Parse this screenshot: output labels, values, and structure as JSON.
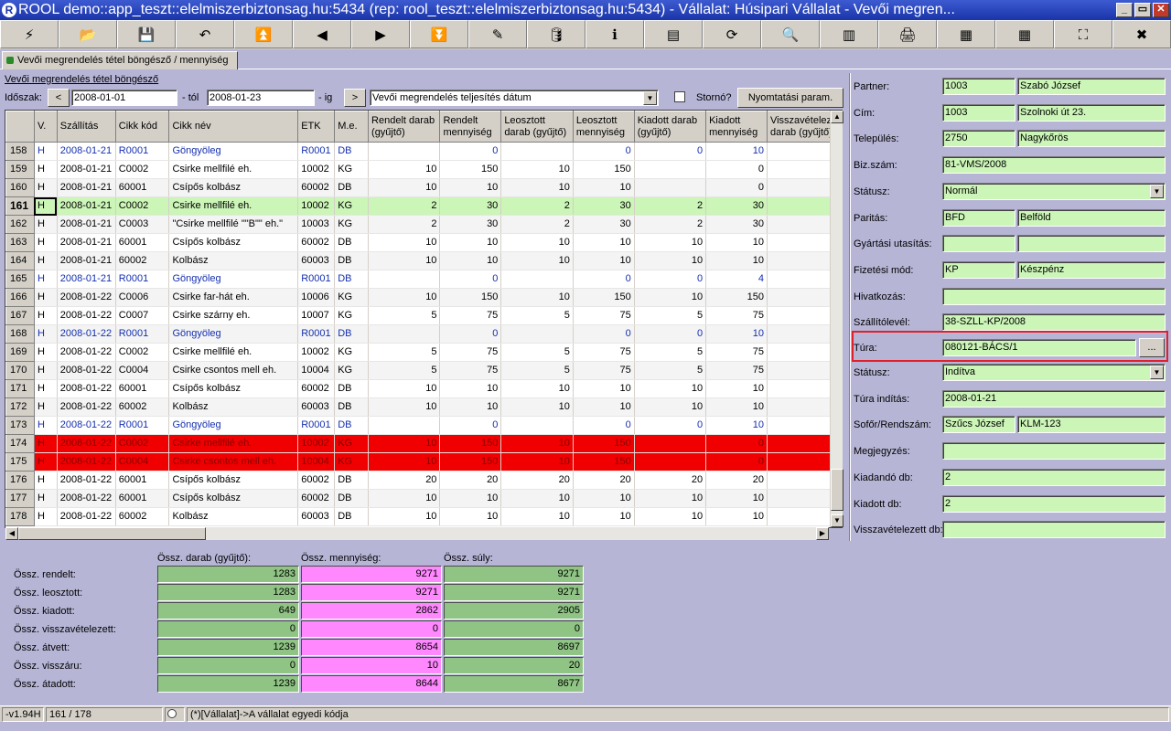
{
  "window": {
    "title": "ROOL demo::app_teszt::elelmiszerbiztonsag.hu:5434 (rep: rool_teszt::elelmiszerbiztonsag.hu:5434) - Vállalat: Húsipari Vállalat - Vevői megren...",
    "app_icon": "app-icon",
    "controls": [
      "_",
      "▭",
      "✕"
    ]
  },
  "toolbar": [
    {
      "icon": "lightning-icon",
      "glyph": "⚡"
    },
    {
      "icon": "open-folder-icon",
      "glyph": "📂"
    },
    {
      "icon": "save-disk-icon",
      "glyph": "💾"
    },
    {
      "icon": "undo-icon",
      "glyph": "↶"
    },
    {
      "icon": "first-record-icon",
      "glyph": "⏫"
    },
    {
      "icon": "previous-icon",
      "glyph": "◀"
    },
    {
      "icon": "next-icon",
      "glyph": "▶"
    },
    {
      "icon": "last-record-icon",
      "glyph": "⏬"
    },
    {
      "icon": "edit-icon",
      "glyph": "✎"
    },
    {
      "icon": "database-icon",
      "glyph": "🛢"
    },
    {
      "icon": "info-icon",
      "glyph": "ℹ"
    },
    {
      "icon": "form-view-icon",
      "glyph": "▤"
    },
    {
      "icon": "refresh-icon",
      "glyph": "⟳"
    },
    {
      "icon": "search-icon",
      "glyph": "🔍"
    },
    {
      "icon": "columns-icon",
      "glyph": "▥"
    },
    {
      "icon": "print-icon",
      "glyph": "🖨"
    },
    {
      "icon": "export-grid-icon",
      "glyph": "▦"
    },
    {
      "icon": "import-grid-icon",
      "glyph": "▦"
    },
    {
      "icon": "fullscreen-icon",
      "glyph": "⛶"
    },
    {
      "icon": "close-icon",
      "glyph": "✖"
    }
  ],
  "tab": {
    "label": "Vevői megrendelés tétel böngésző / mennyiség",
    "icon": "tab-icon"
  },
  "browser": {
    "link": "Vevői megrendelés tétel böngésző",
    "period_label": "Időszak:",
    "prev": "<",
    "next": ">",
    "from_value": "2008-01-01",
    "from_suffix": "- tól",
    "to_value": "2008-01-23",
    "to_suffix": "- ig",
    "date_type": "Vevői megrendelés teljesítés dátum",
    "storno_label": "Stornó?",
    "print_params": "Nyomtatási param."
  },
  "grid": {
    "columns": [
      "V.",
      "Szállítás",
      "Cikk kód",
      "Cikk név",
      "ETK",
      "M.e.",
      "Rendelt darab (gyűjtő)",
      "Rendelt mennyiség",
      "Leosztott darab (gyűjtő)",
      "Leosztott mennyiség",
      "Kiadott darab (gyűjtő)",
      "Kiadott mennyiség",
      "Visszavételez. darab (gyűjtő)"
    ],
    "rows": [
      {
        "n": "158",
        "style": "blue",
        "c": [
          "H",
          "2008-01-21",
          "R0001",
          " Göngyöleg",
          "R0001",
          "DB",
          "",
          "0",
          "",
          "0",
          "0",
          "10",
          ""
        ]
      },
      {
        "n": "159",
        "style": "",
        "c": [
          "H",
          "2008-01-21",
          "C0002",
          "Csirke mellfilé eh.",
          "10002",
          "KG",
          "10",
          "150",
          "10",
          "150",
          "",
          "0",
          ""
        ]
      },
      {
        "n": "160",
        "style": "alt",
        "c": [
          "H",
          "2008-01-21",
          "60001",
          "Csípős kolbász",
          "60002",
          "DB",
          "10",
          "10",
          "10",
          "10",
          "",
          "0",
          ""
        ]
      },
      {
        "n": "161",
        "style": "green",
        "c": [
          "H",
          "2008-01-21",
          "C0002",
          "Csirke mellfilé eh.",
          "10002",
          "KG",
          "2",
          "30",
          "2",
          "30",
          "2",
          "30",
          ""
        ]
      },
      {
        "n": "162",
        "style": "alt",
        "c": [
          "H",
          "2008-01-21",
          "C0003",
          "\"Csirke mellfilé \"\"B\"\" eh.\"",
          "10003",
          "KG",
          "2",
          "30",
          "2",
          "30",
          "2",
          "30",
          ""
        ]
      },
      {
        "n": "163",
        "style": "",
        "c": [
          "H",
          "2008-01-21",
          "60001",
          "Csípős kolbász",
          "60002",
          "DB",
          "10",
          "10",
          "10",
          "10",
          "10",
          "10",
          ""
        ]
      },
      {
        "n": "164",
        "style": "alt",
        "c": [
          "H",
          "2008-01-21",
          "60002",
          "Kolbász",
          "60003",
          "DB",
          "10",
          "10",
          "10",
          "10",
          "10",
          "10",
          ""
        ]
      },
      {
        "n": "165",
        "style": "blue",
        "c": [
          "H",
          "2008-01-21",
          "R0001",
          " Göngyöleg",
          "R0001",
          "DB",
          "",
          "0",
          "",
          "0",
          "0",
          "4",
          ""
        ]
      },
      {
        "n": "166",
        "style": "alt",
        "c": [
          "H",
          "2008-01-22",
          "C0006",
          "Csirke far-hát eh.",
          "10006",
          "KG",
          "10",
          "150",
          "10",
          "150",
          "10",
          "150",
          ""
        ]
      },
      {
        "n": "167",
        "style": "",
        "c": [
          "H",
          "2008-01-22",
          "C0007",
          "Csirke szárny eh.",
          "10007",
          "KG",
          "5",
          "75",
          "5",
          "75",
          "5",
          "75",
          ""
        ]
      },
      {
        "n": "168",
        "style": "blue alt",
        "c": [
          "H",
          "2008-01-22",
          "R0001",
          " Göngyöleg",
          "R0001",
          "DB",
          "",
          "0",
          "",
          "0",
          "0",
          "10",
          ""
        ]
      },
      {
        "n": "169",
        "style": "",
        "c": [
          "H",
          "2008-01-22",
          "C0002",
          "Csirke mellfilé eh.",
          "10002",
          "KG",
          "5",
          "75",
          "5",
          "75",
          "5",
          "75",
          ""
        ]
      },
      {
        "n": "170",
        "style": "alt",
        "c": [
          "H",
          "2008-01-22",
          "C0004",
          "Csirke csontos mell eh.",
          "10004",
          "KG",
          "5",
          "75",
          "5",
          "75",
          "5",
          "75",
          ""
        ]
      },
      {
        "n": "171",
        "style": "",
        "c": [
          "H",
          "2008-01-22",
          "60001",
          "Csípős kolbász",
          "60002",
          "DB",
          "10",
          "10",
          "10",
          "10",
          "10",
          "10",
          ""
        ]
      },
      {
        "n": "172",
        "style": "alt",
        "c": [
          "H",
          "2008-01-22",
          "60002",
          "Kolbász",
          "60003",
          "DB",
          "10",
          "10",
          "10",
          "10",
          "10",
          "10",
          ""
        ]
      },
      {
        "n": "173",
        "style": "blue",
        "c": [
          "H",
          "2008-01-22",
          "R0001",
          " Göngyöleg",
          "R0001",
          "DB",
          "",
          "0",
          "",
          "0",
          "0",
          "10",
          ""
        ]
      },
      {
        "n": "174",
        "style": "red",
        "c": [
          "H",
          "2008-01-22",
          "C0002",
          "Csirke mellfilé eh.",
          "10002",
          "KG",
          "10",
          "150",
          "10",
          "150",
          "",
          "0",
          ""
        ]
      },
      {
        "n": "175",
        "style": "red",
        "c": [
          "H",
          "2008-01-22",
          "C0004",
          "Csirke csontos mell eh.",
          "10004",
          "KG",
          "10",
          "150",
          "10",
          "150",
          "",
          "0",
          ""
        ]
      },
      {
        "n": "176",
        "style": "",
        "c": [
          "H",
          "2008-01-22",
          "60001",
          "Csípős kolbász",
          "60002",
          "DB",
          "20",
          "20",
          "20",
          "20",
          "20",
          "20",
          ""
        ]
      },
      {
        "n": "177",
        "style": "alt",
        "c": [
          "H",
          "2008-01-22",
          "60001",
          "Csípős kolbász",
          "60002",
          "DB",
          "10",
          "10",
          "10",
          "10",
          "10",
          "10",
          ""
        ]
      },
      {
        "n": "178",
        "style": "",
        "c": [
          "H",
          "2008-01-22",
          "60002",
          "Kolbász",
          "60003",
          "DB",
          "10",
          "10",
          "10",
          "10",
          "10",
          "10",
          ""
        ]
      }
    ]
  },
  "detail": {
    "partner": {
      "label": "Partner:",
      "code": "1003",
      "name": "Szabó József"
    },
    "cim": {
      "label": "Cím:",
      "code": "1003",
      "name": "Szolnoki út 23."
    },
    "telepules": {
      "label": "Település:",
      "code": "2750",
      "name": "Nagykőrös"
    },
    "bizszam": {
      "label": "Biz.szám:",
      "value": "81-VMS/2008"
    },
    "statusz1": {
      "label": "Státusz:",
      "value": "Normál"
    },
    "paritas": {
      "label": "Paritás:",
      "code": "BFD",
      "name": "Belföld"
    },
    "gyartasi": {
      "label": "Gyártási utasítás:",
      "code": "",
      "name": ""
    },
    "fizetesi": {
      "label": "Fizetési mód:",
      "code": "KP",
      "name": "Készpénz"
    },
    "hivatkozas": {
      "label": "Hivatkozás:",
      "value": ""
    },
    "szallitolevel": {
      "label": "Szállítólevél:",
      "value": "38-SZLL-KP/2008"
    },
    "tura": {
      "label": "Túra:",
      "value": "080121-BÁCS/1",
      "button": "..."
    },
    "statusz2": {
      "label": "Státusz:",
      "value": "Indítva"
    },
    "turainditas": {
      "label": "Túra indítás:",
      "value": "2008-01-21"
    },
    "sofor": {
      "label": "Sofőr/Rendszám:",
      "name": "Szűcs József",
      "plate": "KLM-123"
    },
    "megjegyzes": {
      "label": "Megjegyzés:",
      "value": ""
    },
    "kiadando": {
      "label": "Kiadandó db:",
      "value": "2"
    },
    "kiadott": {
      "label": "Kiadott db:",
      "value": "2"
    },
    "visszavet": {
      "label": "Visszavételezett db:",
      "value": ""
    }
  },
  "summary": {
    "headers": [
      "Össz. darab (gyűjtő):",
      "Össz. mennyiség:",
      "Össz. súly:"
    ],
    "rows": [
      {
        "label": "Össz. rendelt:",
        "v": [
          "1283",
          "9271",
          "9271"
        ]
      },
      {
        "label": "Össz. leosztott:",
        "v": [
          "1283",
          "9271",
          "9271"
        ]
      },
      {
        "label": "Össz. kiadott:",
        "v": [
          "649",
          "2862",
          "2905"
        ]
      },
      {
        "label": "Össz. visszavételezett:",
        "v": [
          "0",
          "0",
          "0"
        ]
      },
      {
        "label": "Össz. átvett:",
        "v": [
          "1239",
          "8654",
          "8697"
        ]
      },
      {
        "label": "Össz. visszáru:",
        "v": [
          "0",
          "10",
          "20"
        ]
      },
      {
        "label": "Össz. átadott:",
        "v": [
          "1239",
          "8644",
          "8677"
        ]
      }
    ]
  },
  "statusbar": {
    "version": "-v1.94H",
    "position": "161 / 178",
    "hint": "(*)[Vállalat]->A vállalat egyedi kódja"
  }
}
